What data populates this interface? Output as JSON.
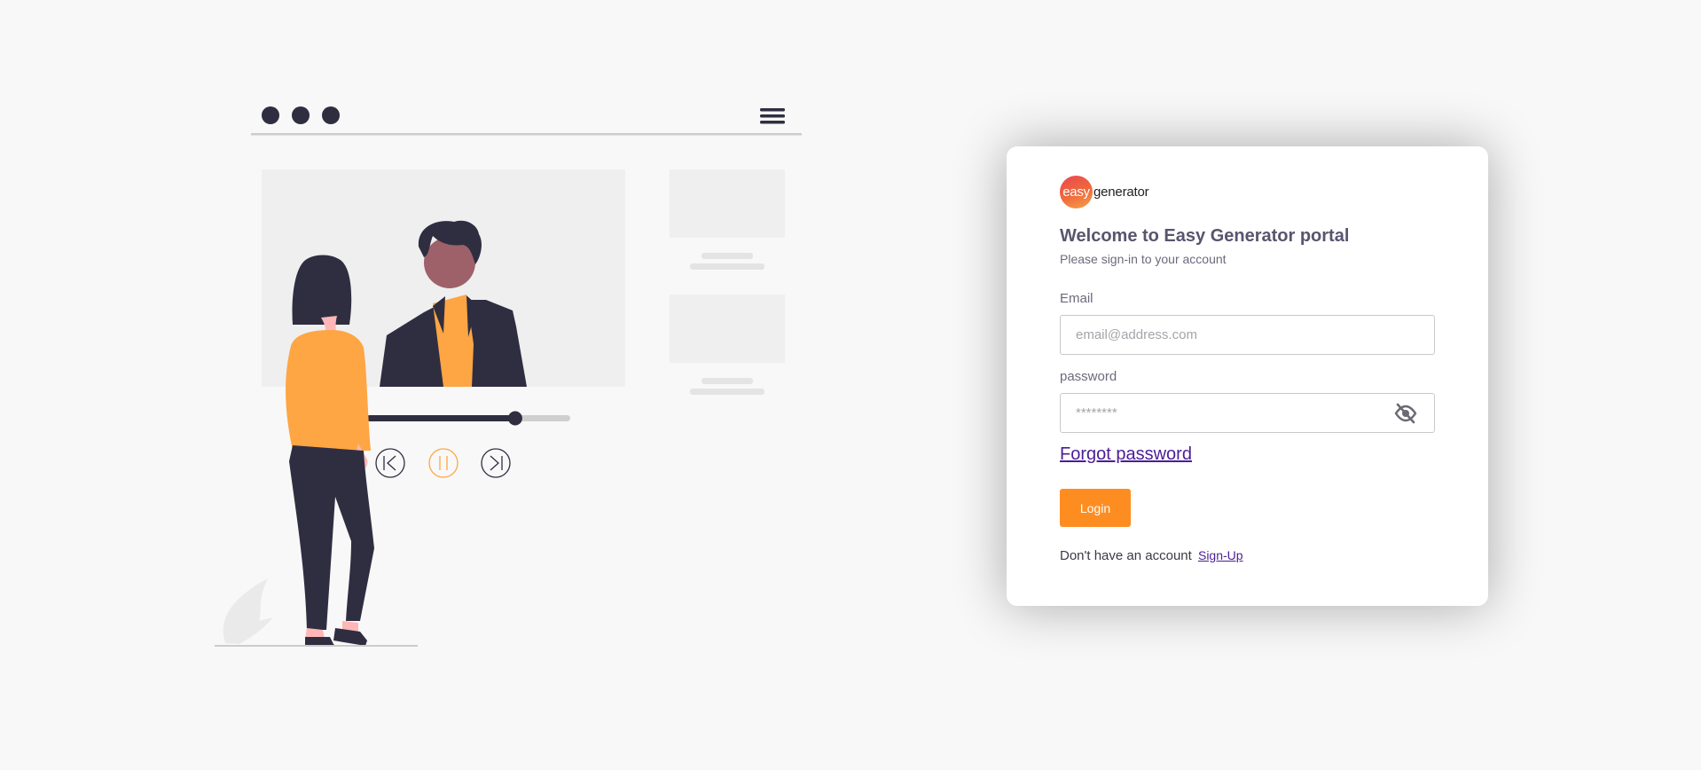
{
  "brand": {
    "logo_mark": "easy",
    "logo_text": "generator"
  },
  "login": {
    "title": "Welcome to Easy Generator portal",
    "subtitle": "Please sign-in to your account",
    "email_label": "Email",
    "email_placeholder": "email@address.com",
    "password_label": "password",
    "password_placeholder": "********",
    "forgot_password": "Forgot password",
    "login_button": "Login",
    "signup_prompt": "Don't have an account",
    "signup_link": "Sign-Up"
  },
  "illustration": {
    "player_progress": 0.73
  },
  "colors": {
    "accent": "#fe8d21",
    "link": "#4b1d96",
    "title": "#58556e",
    "illustration_dark": "#2f2e41",
    "illustration_orange": "#fea643",
    "page_background": "#f8f8f8"
  },
  "icons": [
    "hamburger-menu-icon",
    "previous-track-icon",
    "pause-icon",
    "next-track-icon",
    "eye-slash-icon"
  ]
}
